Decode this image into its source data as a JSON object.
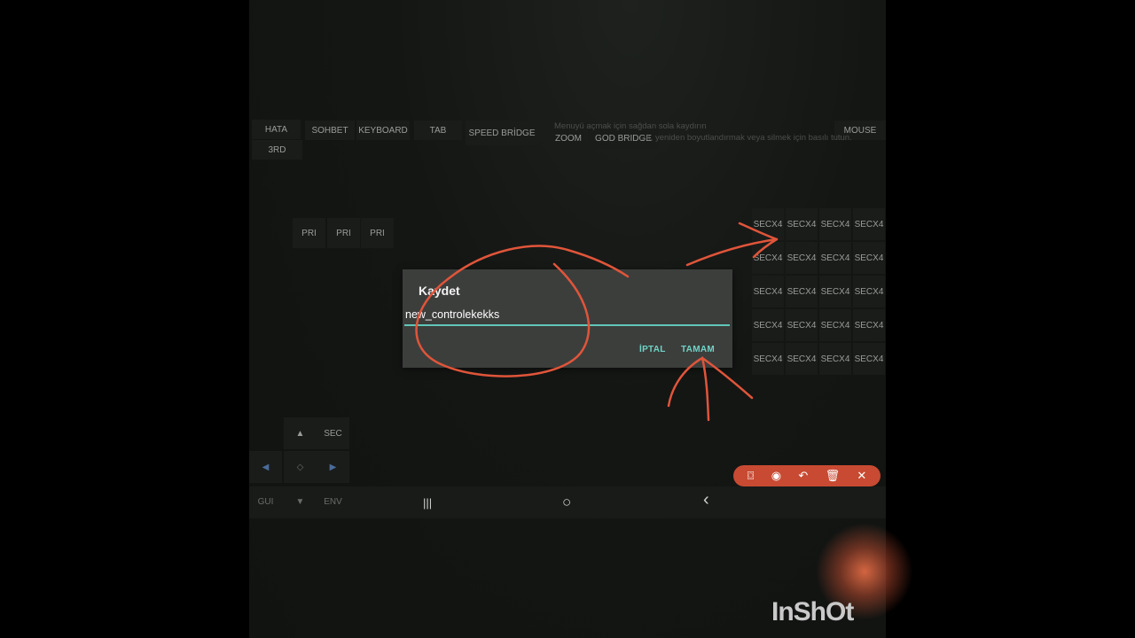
{
  "top_buttons": {
    "hata": "HATA",
    "sohbet": "SOHBET",
    "keyboard": "KEYBOARD",
    "tab": "TAB",
    "speed_bridge": "SPEED BRİDGE",
    "third": "3RD",
    "zoom": "ZOOM",
    "god_bridge": "GOD BRIDGE",
    "mouse": "MOUSE"
  },
  "hints": {
    "line1": "Menuyü açmak için sağdan sola kaydırın",
    "line2": "...k, yeniden boyutlandırmak veya silmek için basılı tutun."
  },
  "pri_buttons": [
    "PRI",
    "PRI",
    "PRI"
  ],
  "sec_grid": {
    "label_top": "SEC",
    "label_bottom": "X4",
    "rows": 5,
    "cols": 4
  },
  "dialog": {
    "title": "Kaydet",
    "input_value": "new_controlekekks",
    "cancel_label": "İPTAL",
    "ok_label": "TAMAM"
  },
  "dpad": {
    "up": "▲",
    "left": "◀",
    "center": "◇",
    "right": "▶",
    "down": "▼",
    "sec": "SEC",
    "gui": "GUI",
    "env": "ENV"
  },
  "nav": {
    "recents_icon": "|||",
    "home_icon": "○",
    "back_icon": "‹"
  },
  "toolbar_icons": [
    "camera-icon",
    "palette-icon",
    "undo-icon",
    "trash-icon",
    "close-icon"
  ],
  "toolbar_glyphs": [
    "⌼",
    "◉",
    "↶",
    "🗑",
    "✕"
  ],
  "watermark": "InShOt",
  "colors": {
    "accent": "#6fd3c4",
    "annotation": "#e0553a",
    "toolbar": "#c84a32"
  }
}
